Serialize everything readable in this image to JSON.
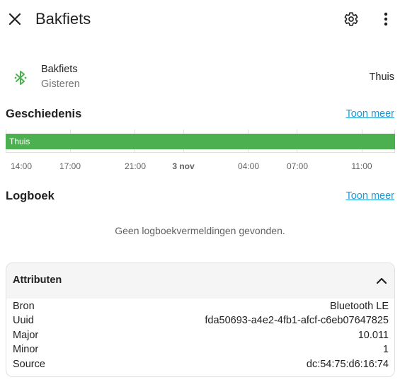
{
  "header": {
    "title": "Bakfiets",
    "close_icon": "close-icon",
    "settings_icon": "gear-icon",
    "more_icon": "more-vertical-icon"
  },
  "entity": {
    "icon": "bluetooth-icon",
    "icon_color": "#4caf50",
    "name": "Bakfiets",
    "last_changed": "Gisteren",
    "state": "Thuis"
  },
  "history": {
    "title": "Geschiedenis",
    "more_link": "Toon meer",
    "bar": {
      "label": "Thuis",
      "color": "#4caf50",
      "fraction": 1.0
    },
    "ticks": [
      {
        "label": "14:00",
        "bold": false
      },
      {
        "label": "17:00",
        "bold": false
      },
      {
        "label": "21:00",
        "bold": false
      },
      {
        "label": "3 nov",
        "bold": true
      },
      {
        "label": "04:00",
        "bold": false
      },
      {
        "label": "07:00",
        "bold": false
      },
      {
        "label": "11:00",
        "bold": false
      }
    ]
  },
  "logbook": {
    "title": "Logboek",
    "more_link": "Toon meer",
    "empty_message": "Geen logboekvermeldingen gevonden."
  },
  "attributes": {
    "title": "Attributen",
    "chevron_icon": "chevron-up-icon",
    "rows": [
      {
        "key": "Bron",
        "value": "Bluetooth LE"
      },
      {
        "key": "Uuid",
        "value": "fda50693-a4e2-4fb1-afcf-c6eb07647825"
      },
      {
        "key": "Major",
        "value": "10.011"
      },
      {
        "key": "Minor",
        "value": "1"
      },
      {
        "key": "Source",
        "value": "dc:54:75:d6:16:74"
      }
    ]
  }
}
